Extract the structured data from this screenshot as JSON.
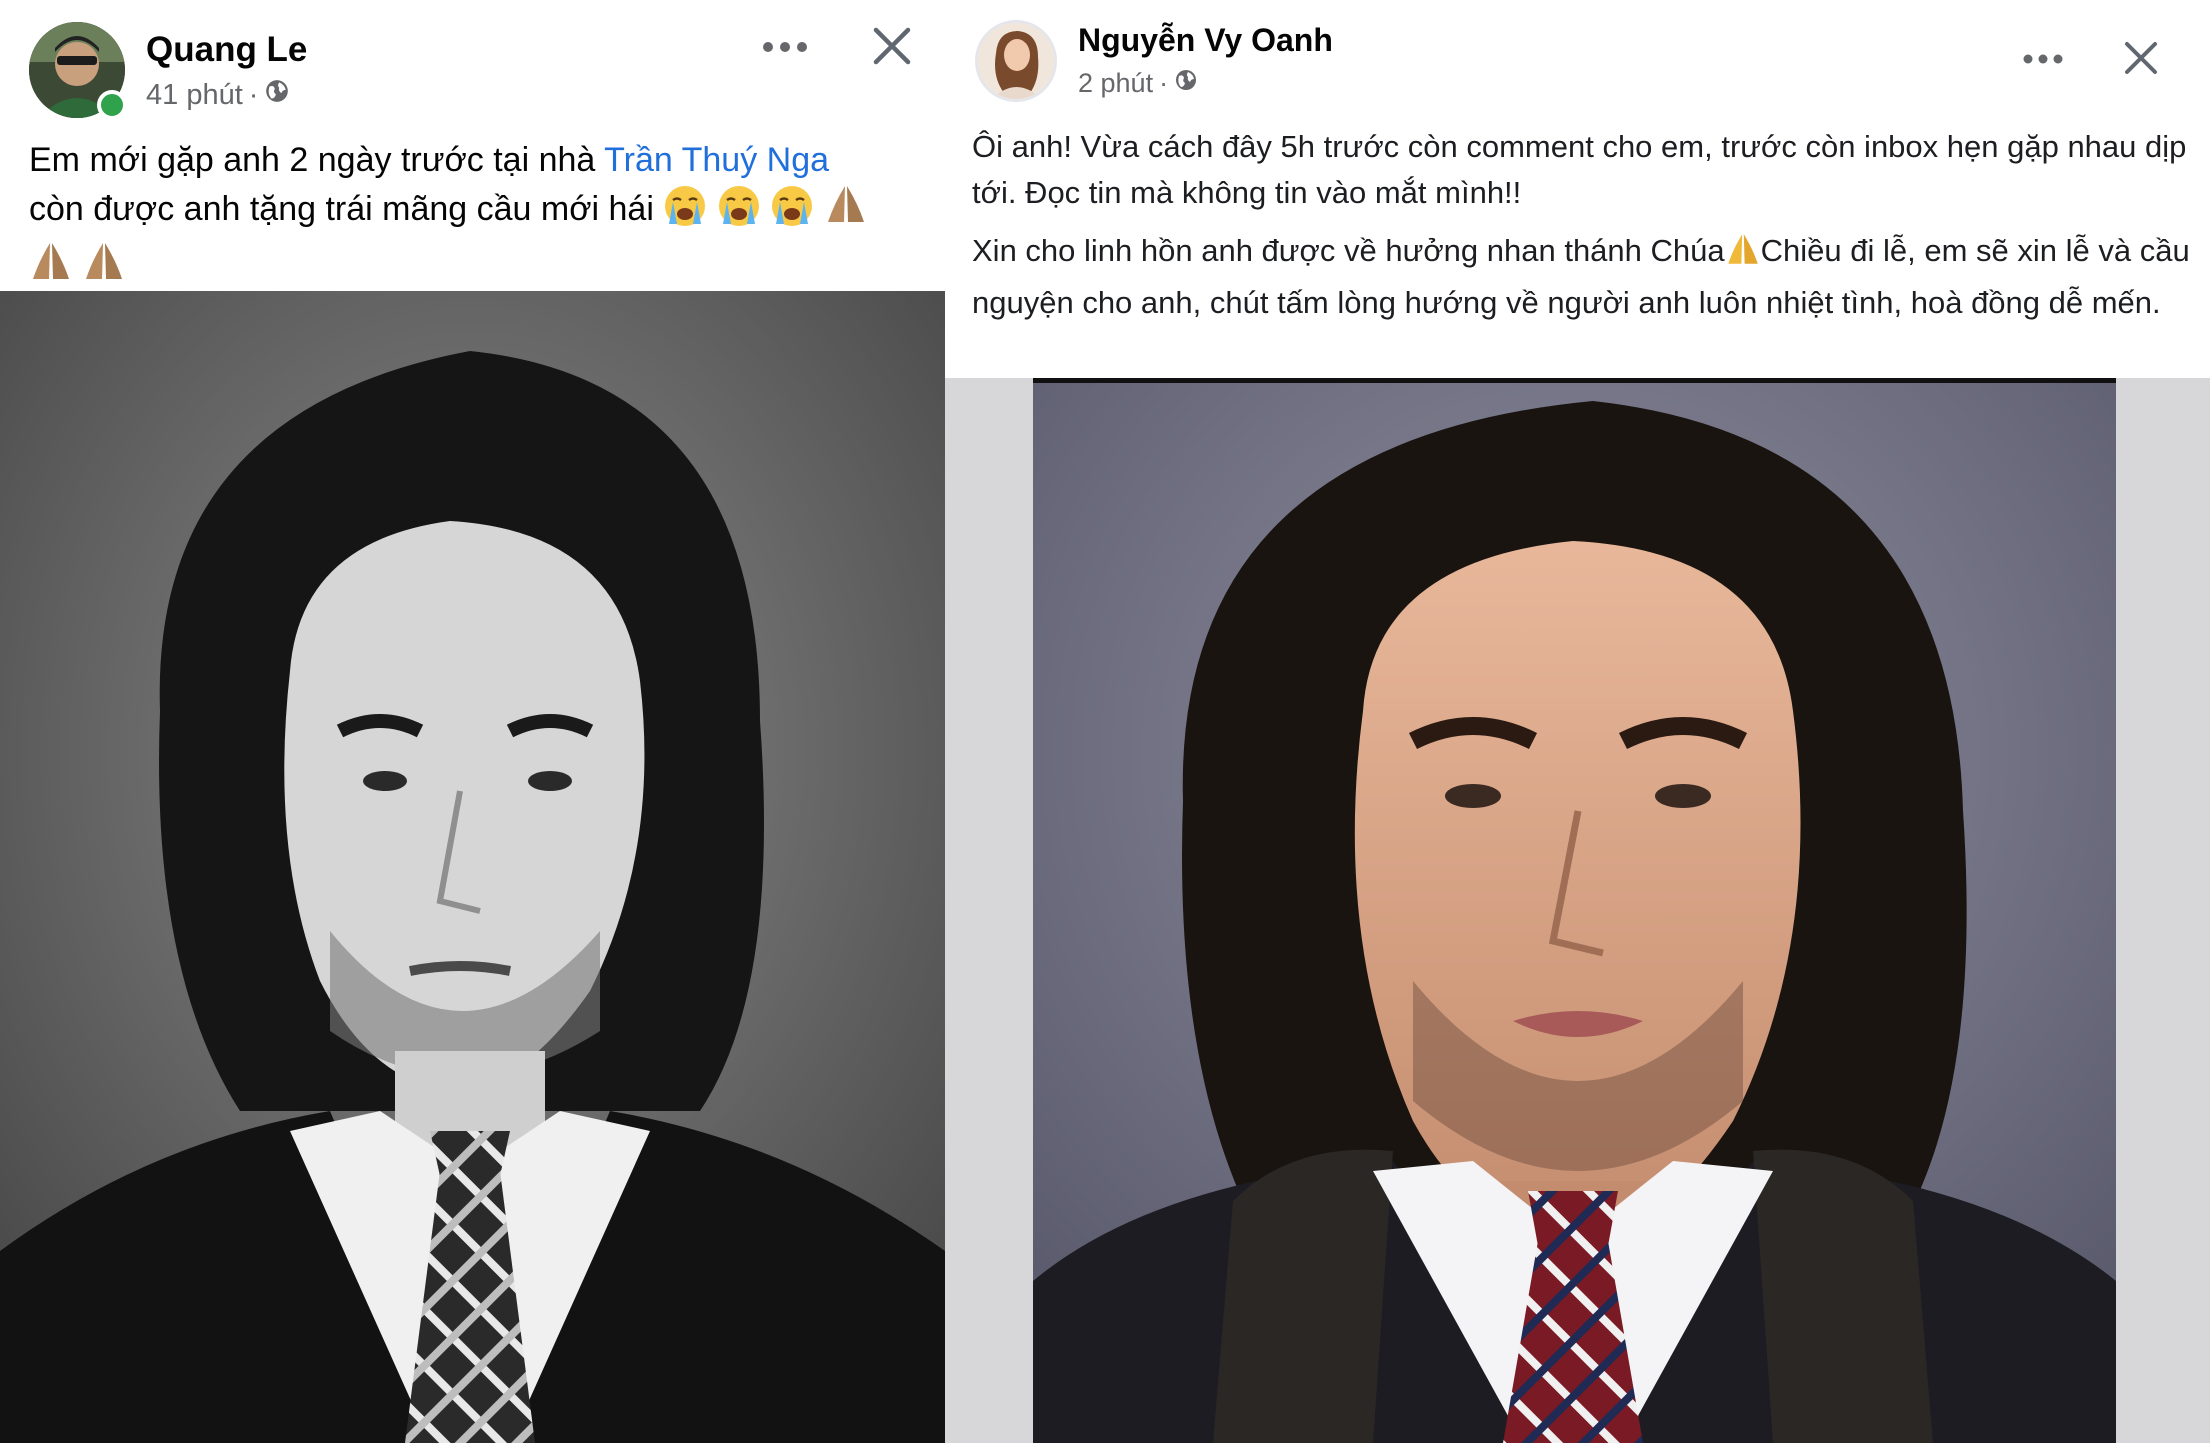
{
  "left_post": {
    "author": "Quang Le",
    "time": "41 phút",
    "separator": "·",
    "audience_icon": "globe-icon",
    "more_icon": "more-horizontal-icon",
    "close_icon": "close-icon",
    "text_before_mention": "Em mới gặp anh 2 ngày trước tại nhà ",
    "mention": "Trần Thuý Nga",
    "text_after_mention": "còn được anh tặng trái mãng cầu mới hái ",
    "emojis": [
      "loudly-crying-face",
      "loudly-crying-face",
      "loudly-crying-face",
      "folded-hands",
      "folded-hands",
      "folded-hands"
    ],
    "photo": "black-and-white portrait of a man with long wavy hair, leather jacket, white shirt and plaid tie"
  },
  "right_post": {
    "author": "Nguyễn Vy Oanh",
    "time": "2 phút",
    "separator": "·",
    "audience_icon": "globe-icon",
    "more_icon": "more-horizontal-icon",
    "close_icon": "close-icon",
    "paragraph1": "Ôi anh! Vừa cách đây 5h trước còn comment cho em, trước còn inbox hẹn gặp nhau dịp tới. Đọc tin mà không tin vào mắt mình!!",
    "paragraph2_before_emoji": "Xin cho linh hồn anh được về hưởng nhan thánh Chúa",
    "paragraph2_after_emoji": "Chiều đi lễ, em sẽ xin lễ và cầu nguyện cho anh, chút tấm lòng hướng về người anh luôn nhiệt tình, hoà đồng dễ mến.",
    "emoji": "folded-hands",
    "photo": "color portrait of a man with long wavy hair, dark jacket, white shirt and plaid tie"
  },
  "colors": {
    "link": "#216fdb",
    "secondary_text": "#65676b",
    "online": "#31a24c"
  }
}
